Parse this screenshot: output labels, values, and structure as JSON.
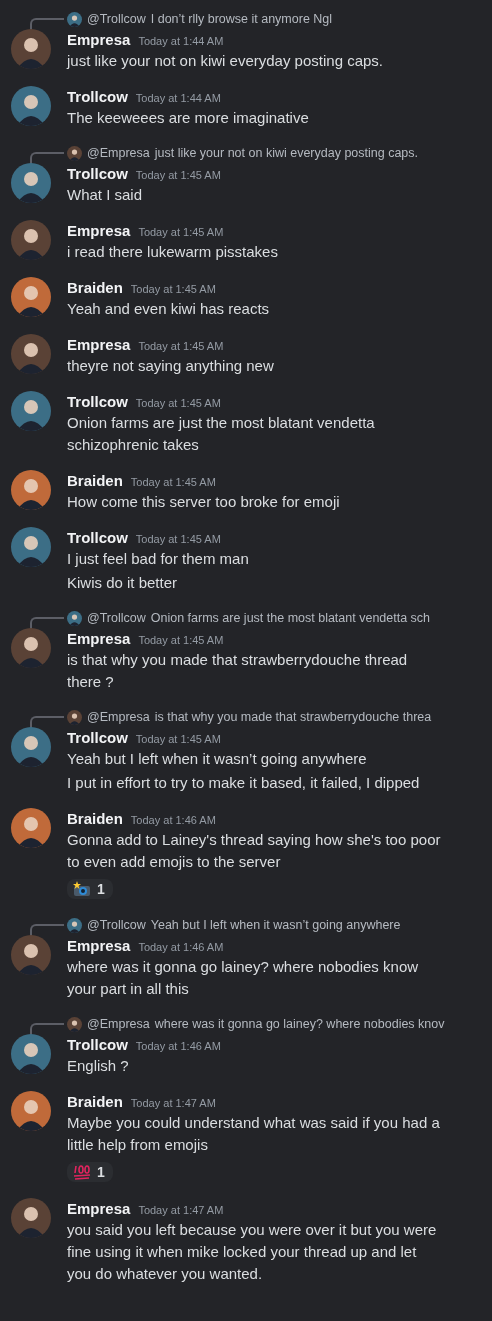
{
  "messages": [
    {
      "author": "Empresa",
      "time": "Today at 1:44 AM",
      "color": "#5a4236",
      "reply": {
        "mention": "@Trollcow",
        "text": "I don’t rlly browse it anymore Ngl",
        "color": "#3c6e86"
      },
      "lines": [
        "just like your not on kiwi everyday posting caps."
      ]
    },
    {
      "author": "Trollcow",
      "time": "Today at 1:44 AM",
      "color": "#3c6e86",
      "lines": [
        "The keeweees are more imaginative"
      ]
    },
    {
      "author": "Trollcow",
      "time": "Today at 1:45 AM",
      "color": "#3c6e86",
      "reply": {
        "mention": "@Empresa",
        "text": "just like your not on kiwi everyday posting caps.",
        "color": "#5a4236"
      },
      "lines": [
        "What I said"
      ]
    },
    {
      "author": "Empresa",
      "time": "Today at 1:45 AM",
      "color": "#5a4236",
      "lines": [
        "i read there lukewarm pisstakes"
      ]
    },
    {
      "author": "Braiden",
      "time": "Today at 1:45 AM",
      "color": "#c06a3a",
      "lines": [
        "Yeah and even kiwi has reacts"
      ]
    },
    {
      "author": "Empresa",
      "time": "Today at 1:45 AM",
      "color": "#5a4236",
      "lines": [
        "theyre not saying anything new"
      ]
    },
    {
      "author": "Trollcow",
      "time": "Today at 1:45 AM",
      "color": "#3c6e86",
      "lines": [
        "Onion farms are just the most blatant vendetta schizophrenic takes"
      ]
    },
    {
      "author": "Braiden",
      "time": "Today at 1:45 AM",
      "color": "#c06a3a",
      "lines": [
        "How come this server too broke for emoji"
      ]
    },
    {
      "author": "Trollcow",
      "time": "Today at 1:45 AM",
      "color": "#3c6e86",
      "lines": [
        "I just feel bad for them man",
        "Kiwis do it better"
      ]
    },
    {
      "author": "Empresa",
      "time": "Today at 1:45 AM",
      "color": "#5a4236",
      "reply": {
        "mention": "@Trollcow",
        "text": "Onion farms are just the most blatant vendetta sch",
        "color": "#3c6e86"
      },
      "lines": [
        "is that why you made that strawberrydouche thread there ?"
      ]
    },
    {
      "author": "Trollcow",
      "time": "Today at 1:45 AM",
      "color": "#3c6e86",
      "reply": {
        "mention": "@Empresa",
        "text": "is that why you made that strawberrydouche threa",
        "color": "#5a4236"
      },
      "lines": [
        "Yeah but I left when it wasn’t going anywhere",
        "I put in effort to try to make it based, it failed, I dipped"
      ]
    },
    {
      "author": "Braiden",
      "time": "Today at 1:46 AM",
      "color": "#c06a3a",
      "lines": [
        "Gonna add to Lainey's thread saying how she's too poor to even add emojis to the server"
      ],
      "reaction": {
        "kind": "camera",
        "count": "1"
      }
    },
    {
      "author": "Empresa",
      "time": "Today at 1:46 AM",
      "color": "#5a4236",
      "reply": {
        "mention": "@Trollcow",
        "text": "Yeah but I left when it wasn’t going anywhere",
        "color": "#3c6e86"
      },
      "lines": [
        "where was it gonna go lainey? where nobodies know your part in all this"
      ]
    },
    {
      "author": "Trollcow",
      "time": "Today at 1:46 AM",
      "color": "#3c6e86",
      "reply": {
        "mention": "@Empresa",
        "text": "where was it gonna go lainey? where nobodies knov",
        "color": "#5a4236"
      },
      "lines": [
        "English ?"
      ]
    },
    {
      "author": "Braiden",
      "time": "Today at 1:47 AM",
      "color": "#c06a3a",
      "lines": [
        "Maybe you could understand what was said if you had a little help from emojis"
      ],
      "reaction": {
        "kind": "hundred",
        "count": "1"
      }
    },
    {
      "author": "Empresa",
      "time": "Today at 1:47 AM",
      "color": "#5a4236",
      "lines": [
        "you said you left because you were over it but you were fine using it when mike locked your thread up and let you do whatever you wanted."
      ]
    }
  ]
}
